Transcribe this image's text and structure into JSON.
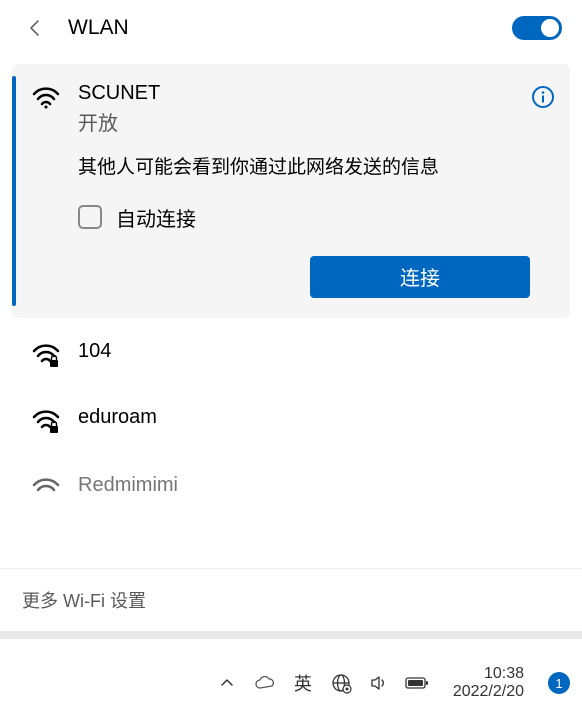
{
  "header": {
    "title": "WLAN",
    "wifi_enabled": true
  },
  "selected_network": {
    "name": "SCUNET",
    "status": "开放",
    "warning": "其他人可能会看到你通过此网络发送的信息",
    "auto_connect_label": "自动连接",
    "connect_label": "连接"
  },
  "networks": [
    {
      "name": "104",
      "secured": true
    },
    {
      "name": "eduroam",
      "secured": true
    },
    {
      "name": "Redmimimi",
      "secured": true
    }
  ],
  "more_settings": "更多 Wi-Fi 设置",
  "taskbar": {
    "ime": "英",
    "time": "10:38",
    "date": "2022/2/20",
    "notif_count": "1"
  }
}
